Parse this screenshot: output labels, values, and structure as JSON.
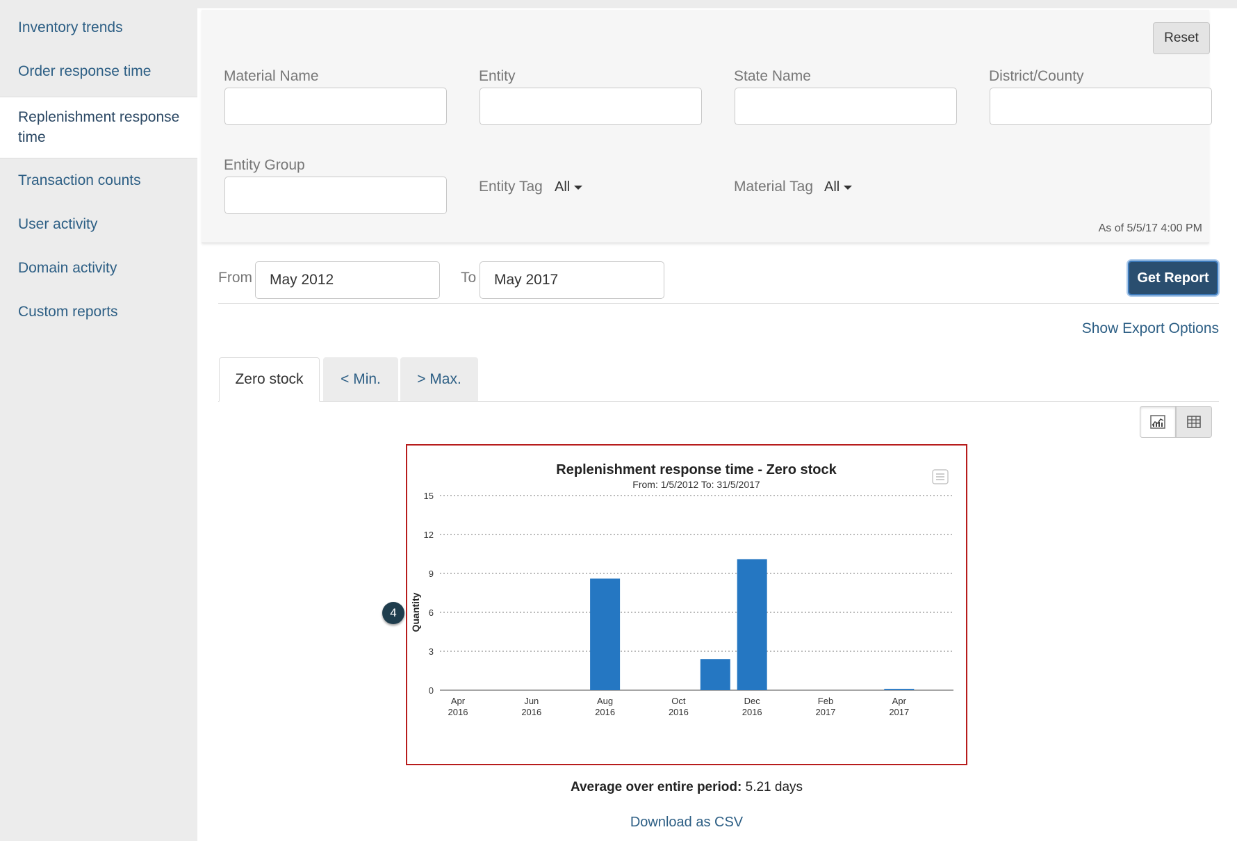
{
  "sidebar": {
    "items": [
      {
        "label": "Inventory trends"
      },
      {
        "label": "Order response time"
      },
      {
        "label": "Replenishment response time"
      },
      {
        "label": "Transaction counts"
      },
      {
        "label": "User activity"
      },
      {
        "label": "Domain activity"
      },
      {
        "label": "Custom reports"
      }
    ]
  },
  "filters": {
    "reset_label": "Reset",
    "material_name": {
      "label": "Material Name",
      "value": ""
    },
    "entity": {
      "label": "Entity",
      "value": ""
    },
    "state_name": {
      "label": "State Name",
      "value": ""
    },
    "district": {
      "label": "District/County",
      "value": ""
    },
    "entity_group": {
      "label": "Entity Group",
      "value": ""
    },
    "entity_tag": {
      "label": "Entity Tag",
      "value": "All"
    },
    "material_tag": {
      "label": "Material Tag",
      "value": "All"
    },
    "as_of": "As of 5/5/17 4:00 PM"
  },
  "dates": {
    "from_label": "From",
    "from_value": "May 2012",
    "to_label": "To",
    "to_value": "May 2017",
    "get_report_label": "Get Report"
  },
  "export_label": "Show Export Options",
  "tabs": [
    {
      "label": "Zero stock"
    },
    {
      "label": "< Min."
    },
    {
      "label": "> Max."
    }
  ],
  "icons": {
    "chart_view": "chart-icon",
    "table_view": "table-icon",
    "chart_menu": "menu-icon"
  },
  "callout": "4",
  "colors": {
    "bar": "#2577c2",
    "frame": "#b71c1c",
    "accent": "#2a4e6f"
  },
  "chart_data": {
    "type": "bar",
    "title": "Replenishment response time - Zero stock",
    "subtitle": "From: 1/5/2012 To: 31/5/2017",
    "ylabel": "Quantity",
    "xlabel": "",
    "ylim": [
      0,
      15
    ],
    "yticks": [
      0,
      3,
      6,
      9,
      12,
      15
    ],
    "grid": true,
    "xticks": [
      {
        "month": "Apr",
        "year": "2016"
      },
      {
        "month": "Jun",
        "year": "2016"
      },
      {
        "month": "Aug",
        "year": "2016"
      },
      {
        "month": "Oct",
        "year": "2016"
      },
      {
        "month": "Dec",
        "year": "2016"
      },
      {
        "month": "Feb",
        "year": "2017"
      },
      {
        "month": "Apr",
        "year": "2017"
      }
    ],
    "categories": [
      "Aug 2016",
      "Nov 2016",
      "Dec 2016",
      "Apr 2017"
    ],
    "values": [
      8.6,
      2.4,
      10.1,
      0.1
    ]
  },
  "average": {
    "label": "Average over entire period:",
    "value": "5.21 days"
  },
  "download_label": "Download as CSV"
}
